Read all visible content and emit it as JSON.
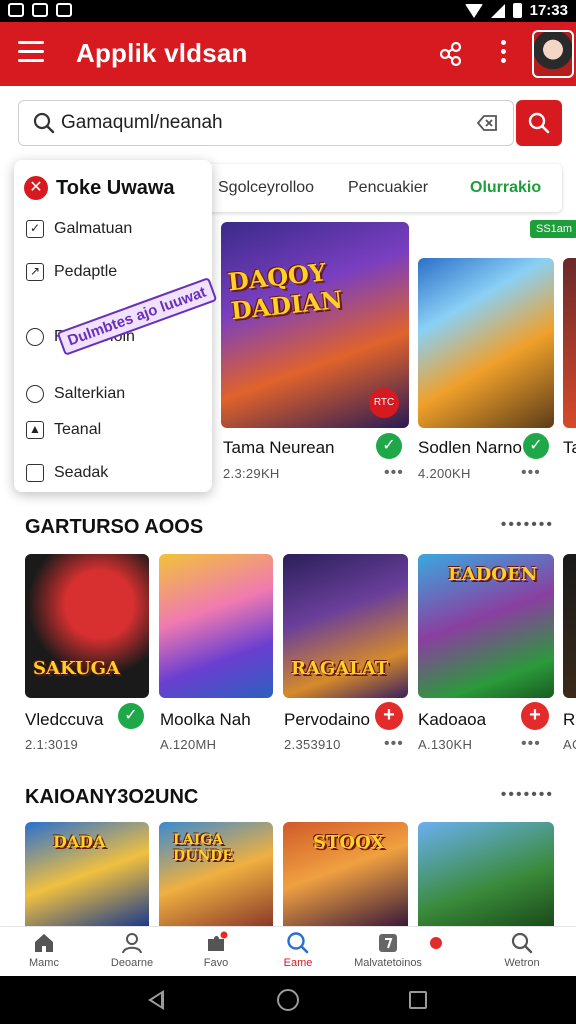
{
  "status_bar": {
    "time": "17:33"
  },
  "app_bar": {
    "title": "Applik vldsan"
  },
  "search": {
    "value": "Gamaquml/neanah",
    "placeholder": ""
  },
  "tabs": [
    {
      "label": "Sgolceyrolloo"
    },
    {
      "label": "Pencuakier"
    },
    {
      "label": "Olurrakio",
      "active": true
    }
  ],
  "dropdown": {
    "title": "Toke Uwawa",
    "items": [
      {
        "label": "Galmatuan",
        "icon": "checkbox-checked-icon"
      },
      {
        "label": "Pedaptle",
        "icon": "checkbox-arrow-icon"
      },
      {
        "label": "Rumgshoin",
        "icon": "chat-icon"
      },
      {
        "label": "Salterkian",
        "icon": "heart-icon"
      },
      {
        "label": "Teanal",
        "icon": "image-icon"
      },
      {
        "label": "Seadak",
        "icon": "checkbox-empty-icon"
      }
    ],
    "sticker": "Dulmbtes ajo luuwat"
  },
  "featured": {
    "badge": "SS1am",
    "cards": [
      {
        "name": "Tama Neurean",
        "size": "2.3:29KH",
        "status": "installed",
        "art_text": "DAQOY DADIAN",
        "rec_label": "RTC"
      },
      {
        "name": "Sodlen Narno",
        "size": "4.200KH",
        "status": "installed"
      },
      {
        "name": "Ta",
        "size": ""
      }
    ]
  },
  "section1": {
    "title": "GARTURSO AOOS",
    "more": "•••••••",
    "games": [
      {
        "name": "Vledccuva",
        "size": "2.1:3019",
        "status": "installed",
        "art_text": "SAKUGA"
      },
      {
        "name": "Moolka Nah",
        "size": "A.120MH",
        "status": ""
      },
      {
        "name": "Pervodaino",
        "size": "2.353910",
        "status": "add",
        "art_text": "RAGALAT"
      },
      {
        "name": "Kadoaoa",
        "size": "A.130KH",
        "status": "add",
        "art_text": "EADOEN"
      },
      {
        "name": "Ru",
        "size": "AC"
      }
    ]
  },
  "section2": {
    "title": "KAIOANY3O2UNC",
    "more": "•••••••",
    "games": [
      {
        "art_text": "DADA"
      },
      {
        "art_text": "LAIGA DUNDE"
      },
      {
        "art_text": "STOOX"
      },
      {
        "art_text": ""
      }
    ]
  },
  "bottom_nav": [
    {
      "label": "Mamc",
      "icon": "home-icon"
    },
    {
      "label": "Deoarne",
      "icon": "person-icon"
    },
    {
      "label": "Favo",
      "icon": "puzzle-icon"
    },
    {
      "label": "Eame",
      "icon": "search-game-icon",
      "active": true
    },
    {
      "label": "Malvatetoinos",
      "icon": "notes-icon"
    },
    {
      "label": "Wetron",
      "icon": "search-icon"
    }
  ],
  "colors": {
    "brand_red": "#d71920",
    "accent_green": "#1e9e3a",
    "install_green": "#1fa84a",
    "add_red": "#e32b2b"
  }
}
